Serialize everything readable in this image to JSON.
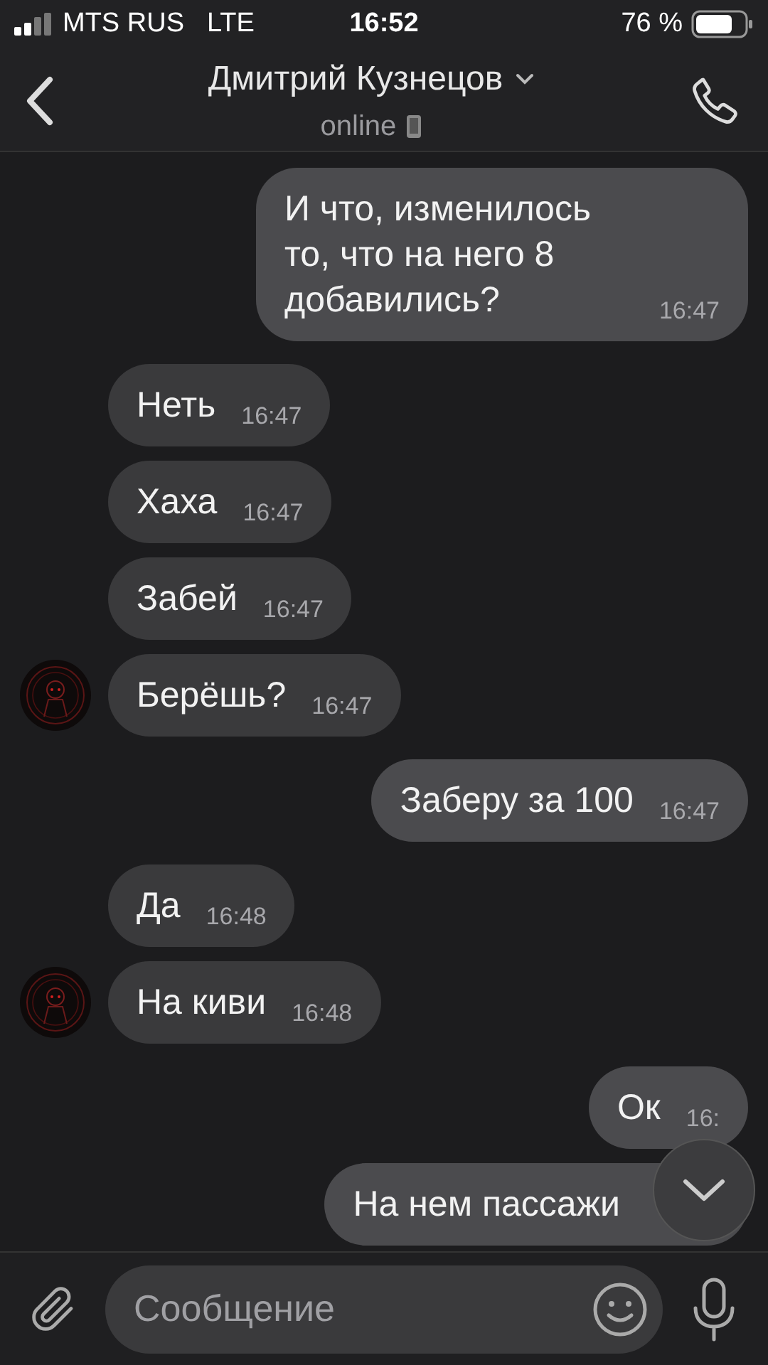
{
  "status_bar": {
    "carrier": "MTS RUS",
    "network": "LTE",
    "time": "16:52",
    "battery": "76 %"
  },
  "header": {
    "title": "Дмитрий Кузнецов",
    "presence": "online"
  },
  "messages": [
    {
      "kind": "outgoing",
      "text": "И что, изменилось то, что на него 8 добавились?",
      "time": "16:47"
    },
    {
      "kind": "incoming",
      "text": "Неть",
      "time": "16:47",
      "avatar": false
    },
    {
      "kind": "incoming",
      "text": "Хаха",
      "time": "16:47",
      "avatar": false
    },
    {
      "kind": "incoming",
      "text": "Забей",
      "time": "16:47",
      "avatar": false
    },
    {
      "kind": "incoming",
      "text": "Берёшь?",
      "time": "16:47",
      "avatar": true
    },
    {
      "kind": "outgoing",
      "text": "Заберу за 100",
      "time": "16:47"
    },
    {
      "kind": "incoming",
      "text": "Да",
      "time": "16:48",
      "avatar": false
    },
    {
      "kind": "incoming",
      "text": "На киви",
      "time": "16:48",
      "avatar": true
    },
    {
      "kind": "outgoing",
      "text": "Ок",
      "time": "16:"
    },
    {
      "kind": "outgoing",
      "text": "На нем пассажи"
    }
  ],
  "composer": {
    "placeholder": "Сообщение"
  }
}
